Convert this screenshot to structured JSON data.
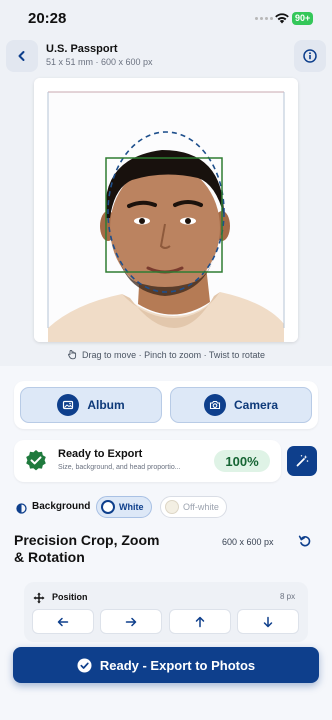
{
  "status": {
    "time": "20:28",
    "battery": "90+"
  },
  "header": {
    "title": "U.S. Passport",
    "subtitle": "51 x 51 mm · 600 x 600 px"
  },
  "editor": {
    "hint": "Drag to move · Pinch to zoom · Twist to rotate"
  },
  "source": {
    "album_label": "Album",
    "camera_label": "Camera"
  },
  "readiness": {
    "title": "Ready to Export",
    "description": "Size, background, and head proportio...",
    "percent": "100%"
  },
  "background": {
    "label": "Background",
    "options": [
      {
        "label": "White",
        "selected": true,
        "color": "#ffffff"
      },
      {
        "label": "Off-white",
        "selected": false,
        "color": "#f3efe3"
      }
    ]
  },
  "crop": {
    "title": "Precision Crop, Zoom & Rotation",
    "size": "600 x 600 px",
    "position_label": "Position",
    "step": "8 px"
  },
  "actions": {
    "export_label": "Ready - Export to Photos"
  },
  "colors": {
    "primary": "#0e3f8c",
    "success": "#166534",
    "success_bg": "#dff3e6",
    "guide_green": "#2e7d32"
  }
}
